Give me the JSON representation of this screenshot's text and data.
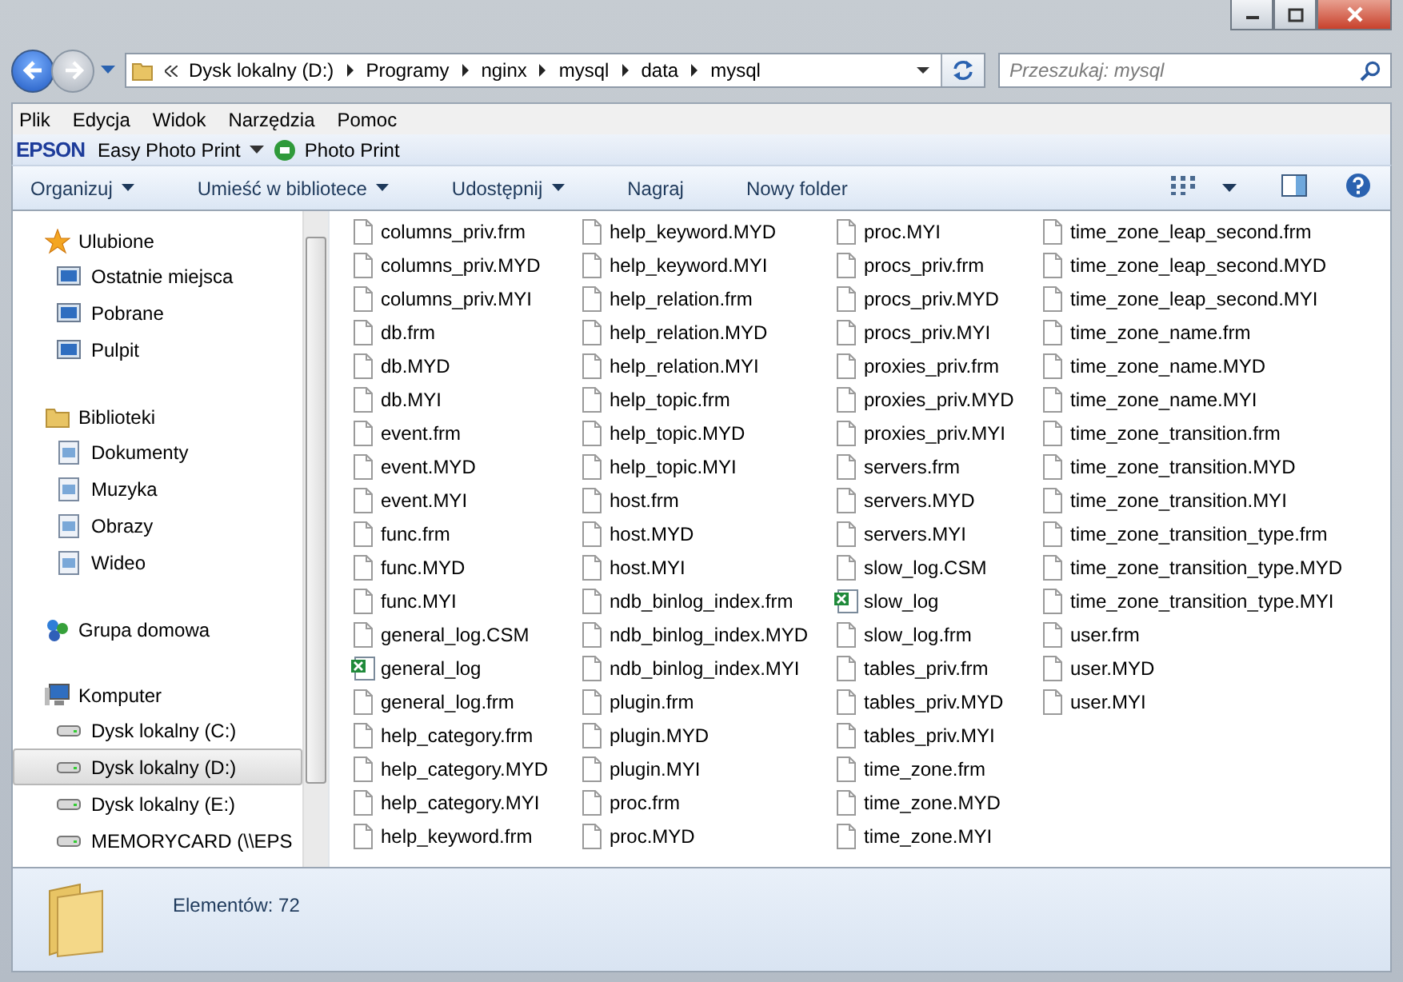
{
  "address": {
    "crumbs": [
      "Dysk lokalny (D:)",
      "Programy",
      "nginx",
      "mysql",
      "data",
      "mysql"
    ]
  },
  "search": {
    "placeholder": "Przeszukaj: mysql"
  },
  "menu": [
    "Plik",
    "Edycja",
    "Widok",
    "Narzędzia",
    "Pomoc"
  ],
  "epson_bar": {
    "logo": "EPSON",
    "items": [
      {
        "label": "Easy Photo Print",
        "dropdown": true
      },
      {
        "label": "Photo Print",
        "dropdown": false
      }
    ]
  },
  "command_bar": [
    {
      "label": "Organizuj",
      "dropdown": true
    },
    {
      "label": "Umieść w bibliotece",
      "dropdown": true
    },
    {
      "label": "Udostępnij",
      "dropdown": true
    },
    {
      "label": "Nagraj",
      "dropdown": false
    },
    {
      "label": "Nowy folder",
      "dropdown": false
    }
  ],
  "sidebar": {
    "groups": [
      {
        "label": "Ulubione",
        "children": [
          {
            "label": "Ostatnie miejsca",
            "selected": false
          },
          {
            "label": "Pobrane",
            "selected": false
          },
          {
            "label": "Pulpit",
            "selected": false
          }
        ]
      },
      {
        "label": "Biblioteki",
        "children": [
          {
            "label": "Dokumenty",
            "selected": false
          },
          {
            "label": "Muzyka",
            "selected": false
          },
          {
            "label": "Obrazy",
            "selected": false
          },
          {
            "label": "Wideo",
            "selected": false
          }
        ]
      },
      {
        "label": "Grupa domowa"
      },
      {
        "label": "Komputer",
        "children": [
          {
            "label": "Dysk lokalny (C:)",
            "selected": false
          },
          {
            "label": "Dysk lokalny (D:)",
            "selected": true
          },
          {
            "label": "Dysk lokalny (E:)",
            "selected": false
          },
          {
            "label": "MEMORYCARD (\\\\EPS",
            "selected": false
          }
        ]
      }
    ]
  },
  "files": [
    {
      "name": "columns_priv.frm",
      "kind": "file"
    },
    {
      "name": "columns_priv.MYD",
      "kind": "file"
    },
    {
      "name": "columns_priv.MYI",
      "kind": "file"
    },
    {
      "name": "db.frm",
      "kind": "file"
    },
    {
      "name": "db.MYD",
      "kind": "file"
    },
    {
      "name": "db.MYI",
      "kind": "file"
    },
    {
      "name": "event.frm",
      "kind": "file"
    },
    {
      "name": "event.MYD",
      "kind": "file"
    },
    {
      "name": "event.MYI",
      "kind": "file"
    },
    {
      "name": "func.frm",
      "kind": "file"
    },
    {
      "name": "func.MYD",
      "kind": "file"
    },
    {
      "name": "func.MYI",
      "kind": "file"
    },
    {
      "name": "general_log.CSM",
      "kind": "file"
    },
    {
      "name": "general_log",
      "kind": "spreadsheet"
    },
    {
      "name": "general_log.frm",
      "kind": "file"
    },
    {
      "name": "help_category.frm",
      "kind": "file"
    },
    {
      "name": "help_category.MYD",
      "kind": "file"
    },
    {
      "name": "help_category.MYI",
      "kind": "file"
    },
    {
      "name": "help_keyword.frm",
      "kind": "file"
    },
    {
      "name": "help_keyword.MYD",
      "kind": "file"
    },
    {
      "name": "help_keyword.MYI",
      "kind": "file"
    },
    {
      "name": "help_relation.frm",
      "kind": "file"
    },
    {
      "name": "help_relation.MYD",
      "kind": "file"
    },
    {
      "name": "help_relation.MYI",
      "kind": "file"
    },
    {
      "name": "help_topic.frm",
      "kind": "file"
    },
    {
      "name": "help_topic.MYD",
      "kind": "file"
    },
    {
      "name": "help_topic.MYI",
      "kind": "file"
    },
    {
      "name": "host.frm",
      "kind": "file"
    },
    {
      "name": "host.MYD",
      "kind": "file"
    },
    {
      "name": "host.MYI",
      "kind": "file"
    },
    {
      "name": "ndb_binlog_index.frm",
      "kind": "file"
    },
    {
      "name": "ndb_binlog_index.MYD",
      "kind": "file"
    },
    {
      "name": "ndb_binlog_index.MYI",
      "kind": "file"
    },
    {
      "name": "plugin.frm",
      "kind": "file"
    },
    {
      "name": "plugin.MYD",
      "kind": "file"
    },
    {
      "name": "plugin.MYI",
      "kind": "file"
    },
    {
      "name": "proc.frm",
      "kind": "file"
    },
    {
      "name": "proc.MYD",
      "kind": "file"
    },
    {
      "name": "proc.MYI",
      "kind": "file"
    },
    {
      "name": "procs_priv.frm",
      "kind": "file"
    },
    {
      "name": "procs_priv.MYD",
      "kind": "file"
    },
    {
      "name": "procs_priv.MYI",
      "kind": "file"
    },
    {
      "name": "proxies_priv.frm",
      "kind": "file"
    },
    {
      "name": "proxies_priv.MYD",
      "kind": "file"
    },
    {
      "name": "proxies_priv.MYI",
      "kind": "file"
    },
    {
      "name": "servers.frm",
      "kind": "file"
    },
    {
      "name": "servers.MYD",
      "kind": "file"
    },
    {
      "name": "servers.MYI",
      "kind": "file"
    },
    {
      "name": "slow_log.CSM",
      "kind": "file"
    },
    {
      "name": "slow_log",
      "kind": "spreadsheet"
    },
    {
      "name": "slow_log.frm",
      "kind": "file"
    },
    {
      "name": "tables_priv.frm",
      "kind": "file"
    },
    {
      "name": "tables_priv.MYD",
      "kind": "file"
    },
    {
      "name": "tables_priv.MYI",
      "kind": "file"
    },
    {
      "name": "time_zone.frm",
      "kind": "file"
    },
    {
      "name": "time_zone.MYD",
      "kind": "file"
    },
    {
      "name": "time_zone.MYI",
      "kind": "file"
    },
    {
      "name": "time_zone_leap_second.frm",
      "kind": "file"
    },
    {
      "name": "time_zone_leap_second.MYD",
      "kind": "file"
    },
    {
      "name": "time_zone_leap_second.MYI",
      "kind": "file"
    },
    {
      "name": "time_zone_name.frm",
      "kind": "file"
    },
    {
      "name": "time_zone_name.MYD",
      "kind": "file"
    },
    {
      "name": "time_zone_name.MYI",
      "kind": "file"
    },
    {
      "name": "time_zone_transition.frm",
      "kind": "file"
    },
    {
      "name": "time_zone_transition.MYD",
      "kind": "file"
    },
    {
      "name": "time_zone_transition.MYI",
      "kind": "file"
    },
    {
      "name": "time_zone_transition_type.frm",
      "kind": "file"
    },
    {
      "name": "time_zone_transition_type.MYD",
      "kind": "file"
    },
    {
      "name": "time_zone_transition_type.MYI",
      "kind": "file"
    },
    {
      "name": "user.frm",
      "kind": "file"
    },
    {
      "name": "user.MYD",
      "kind": "file"
    },
    {
      "name": "user.MYI",
      "kind": "file"
    }
  ],
  "status_bar": {
    "text": "Elementów: 72"
  }
}
